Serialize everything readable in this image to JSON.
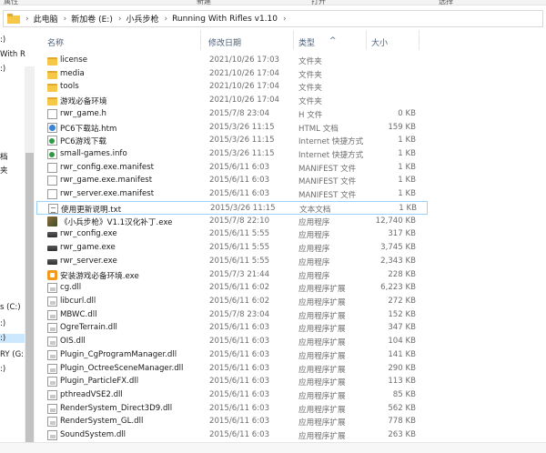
{
  "ribbon": {
    "items": [
      "属性",
      "新建",
      "打开",
      "选择"
    ]
  },
  "address": {
    "crumbs": [
      "此电脑",
      "新加卷 (E:)",
      "小兵步枪",
      "Running With Rifles v1.10"
    ]
  },
  "nav": {
    "items": [
      {
        "label": ":)",
        "sel": false
      },
      {
        "label": "With R",
        "sel": false
      },
      {
        "label": ":)",
        "sel": false
      },
      {
        "label": "档",
        "sel": false
      },
      {
        "label": "夹",
        "sel": false
      },
      {
        "label": "s (C:)",
        "sel": false
      },
      {
        "label": ":)",
        "sel": false
      },
      {
        "label": ":)",
        "sel": true
      },
      {
        "label": "RY (G:)",
        "sel": false
      },
      {
        "label": ":)",
        "sel": false
      }
    ]
  },
  "columns": {
    "name": "名称",
    "date": "修改日期",
    "type": "类型",
    "size": "大小"
  },
  "files": [
    {
      "name": "license",
      "date": "2021/10/26 17:03",
      "type": "文件夹",
      "size": "",
      "icon": "folder-icon"
    },
    {
      "name": "media",
      "date": "2021/10/26 17:04",
      "type": "文件夹",
      "size": "",
      "icon": "folder-icon"
    },
    {
      "name": "tools",
      "date": "2021/10/26 17:04",
      "type": "文件夹",
      "size": "",
      "icon": "folder-icon"
    },
    {
      "name": "游戏必备环境",
      "date": "2021/10/26 17:04",
      "type": "文件夹",
      "size": "",
      "icon": "folder-icon"
    },
    {
      "name": "rwr_game.h",
      "date": "2015/7/8 23:04",
      "type": "H 文件",
      "size": "0 KB",
      "icon": "file-icon"
    },
    {
      "name": "PC6下载站.htm",
      "date": "2015/3/26 11:15",
      "type": "HTML 文档",
      "size": "159 KB",
      "icon": "html-icon"
    },
    {
      "name": "PC6游戏下载",
      "date": "2015/3/26 11:15",
      "type": "Internet 快捷方式",
      "size": "1 KB",
      "icon": "link-icon"
    },
    {
      "name": "small-games.info",
      "date": "2015/3/26 11:15",
      "type": "Internet 快捷方式",
      "size": "1 KB",
      "icon": "link-icon"
    },
    {
      "name": "rwr_config.exe.manifest",
      "date": "2015/6/11 6:03",
      "type": "MANIFEST 文件",
      "size": "1 KB",
      "icon": "file-icon"
    },
    {
      "name": "rwr_game.exe.manifest",
      "date": "2015/6/11 6:03",
      "type": "MANIFEST 文件",
      "size": "1 KB",
      "icon": "file-icon"
    },
    {
      "name": "rwr_server.exe.manifest",
      "date": "2015/6/11 6:03",
      "type": "MANIFEST 文件",
      "size": "1 KB",
      "icon": "file-icon"
    },
    {
      "name": "使用更新说明.txt",
      "date": "2015/3/26 11:15",
      "type": "文本文档",
      "size": "1 KB",
      "icon": "text-file-icon",
      "selected": true
    },
    {
      "name": "《小兵步枪》V1.1汉化补丁.exe",
      "date": "2015/7/8 22:10",
      "type": "应用程序",
      "size": "12,740 KB",
      "icon": "patch-exe-icon"
    },
    {
      "name": "rwr_config.exe",
      "date": "2015/6/11 5:55",
      "type": "应用程序",
      "size": "317 KB",
      "icon": "rifle-exe-icon"
    },
    {
      "name": "rwr_game.exe",
      "date": "2015/6/11 5:55",
      "type": "应用程序",
      "size": "3,745 KB",
      "icon": "rifle-exe-icon"
    },
    {
      "name": "rwr_server.exe",
      "date": "2015/6/11 5:55",
      "type": "应用程序",
      "size": "2,343 KB",
      "icon": "rifle-exe-icon"
    },
    {
      "name": "安装游戏必备环境.exe",
      "date": "2015/7/3 21:44",
      "type": "应用程序",
      "size": "228 KB",
      "icon": "installer-exe-icon"
    },
    {
      "name": "cg.dll",
      "date": "2015/6/11 6:02",
      "type": "应用程序扩展",
      "size": "6,223 KB",
      "icon": "dll-icon"
    },
    {
      "name": "libcurl.dll",
      "date": "2015/6/11 6:02",
      "type": "应用程序扩展",
      "size": "272 KB",
      "icon": "dll-icon"
    },
    {
      "name": "MBWC.dll",
      "date": "2015/7/8 23:04",
      "type": "应用程序扩展",
      "size": "152 KB",
      "icon": "dll-icon"
    },
    {
      "name": "OgreTerrain.dll",
      "date": "2015/6/11 6:03",
      "type": "应用程序扩展",
      "size": "347 KB",
      "icon": "dll-icon"
    },
    {
      "name": "OIS.dll",
      "date": "2015/6/11 6:03",
      "type": "应用程序扩展",
      "size": "104 KB",
      "icon": "dll-icon"
    },
    {
      "name": "Plugin_CgProgramManager.dll",
      "date": "2015/6/11 6:03",
      "type": "应用程序扩展",
      "size": "141 KB",
      "icon": "dll-icon"
    },
    {
      "name": "Plugin_OctreeSceneManager.dll",
      "date": "2015/6/11 6:03",
      "type": "应用程序扩展",
      "size": "290 KB",
      "icon": "dll-icon"
    },
    {
      "name": "Plugin_ParticleFX.dll",
      "date": "2015/6/11 6:03",
      "type": "应用程序扩展",
      "size": "113 KB",
      "icon": "dll-icon"
    },
    {
      "name": "pthreadVSE2.dll",
      "date": "2015/6/11 6:03",
      "type": "应用程序扩展",
      "size": "85 KB",
      "icon": "dll-icon"
    },
    {
      "name": "RenderSystem_Direct3D9.dll",
      "date": "2015/6/11 6:03",
      "type": "应用程序扩展",
      "size": "562 KB",
      "icon": "dll-icon"
    },
    {
      "name": "RenderSystem_GL.dll",
      "date": "2015/6/11 6:03",
      "type": "应用程序扩展",
      "size": "778 KB",
      "icon": "dll-icon"
    },
    {
      "name": "SoundSystem.dll",
      "date": "2015/6/11 6:03",
      "type": "应用程序扩展",
      "size": "263 KB",
      "icon": "dll-icon"
    }
  ]
}
